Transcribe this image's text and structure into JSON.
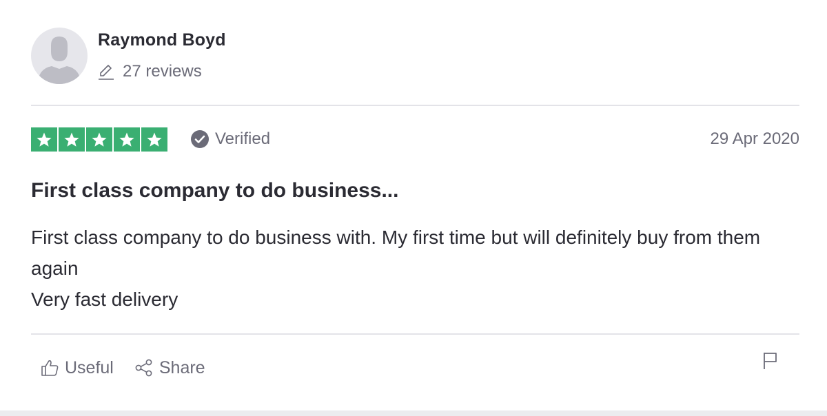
{
  "reviewer": {
    "name": "Raymond Boyd",
    "reviews_count": "27 reviews",
    "avatar_icon": "user-silhouette-icon"
  },
  "review": {
    "rating": 5,
    "rating_max": 5,
    "star_color": "#3aaf72",
    "verified_label": "Verified",
    "date": "29 Apr 2020",
    "title": "First class company to do business...",
    "body_lines": [
      "First class company to do business with. My first time but will definitely buy from them again",
      "Very fast delivery"
    ]
  },
  "actions": {
    "useful_label": "Useful",
    "share_label": "Share",
    "useful_icon": "thumbs-up-icon",
    "share_icon": "share-icon",
    "flag_icon": "flag-icon"
  }
}
